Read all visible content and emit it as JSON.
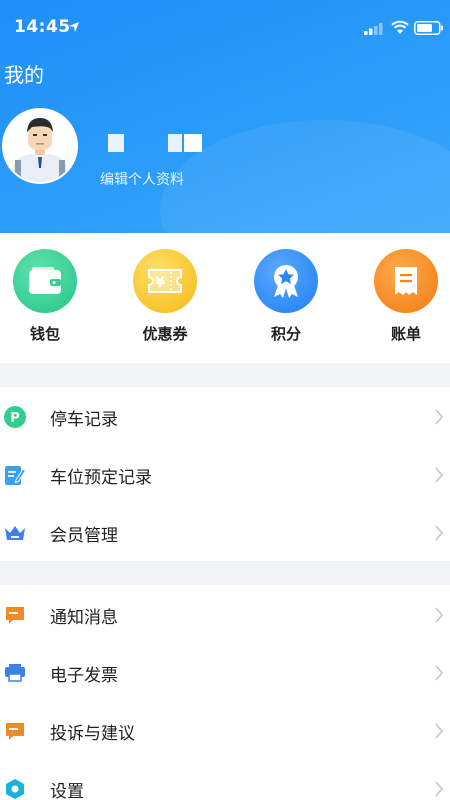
{
  "status_bar": {
    "time": "14:45"
  },
  "header": {
    "title": "我的",
    "edit_profile": "编辑个人资料"
  },
  "quick_actions": [
    {
      "label": "钱包",
      "icon": "wallet-icon",
      "color": "#2fcf8f"
    },
    {
      "label": "优惠券",
      "icon": "coupon-icon",
      "color": "#f7c21f"
    },
    {
      "label": "积分",
      "icon": "points-badge-icon",
      "color": "#2a8ff5"
    },
    {
      "label": "账单",
      "icon": "bill-icon",
      "color": "#f7891e"
    }
  ],
  "menu_group_1": [
    {
      "label": "停车记录",
      "icon": "parking-icon"
    },
    {
      "label": "车位预定记录",
      "icon": "edit-icon"
    },
    {
      "label": "会员管理",
      "icon": "crown-icon"
    }
  ],
  "menu_group_2": [
    {
      "label": "通知消息",
      "icon": "message-icon"
    },
    {
      "label": "电子发票",
      "icon": "printer-icon"
    },
    {
      "label": "投诉与建议",
      "icon": "feedback-icon"
    },
    {
      "label": "设置",
      "icon": "settings-hex-icon"
    }
  ],
  "colors": {
    "header_blue": "#1f8ff7",
    "parking_green": "#2fcf8f",
    "orange": "#f08a24",
    "blue": "#3b82e6",
    "chevron": "#c6c6cc"
  }
}
